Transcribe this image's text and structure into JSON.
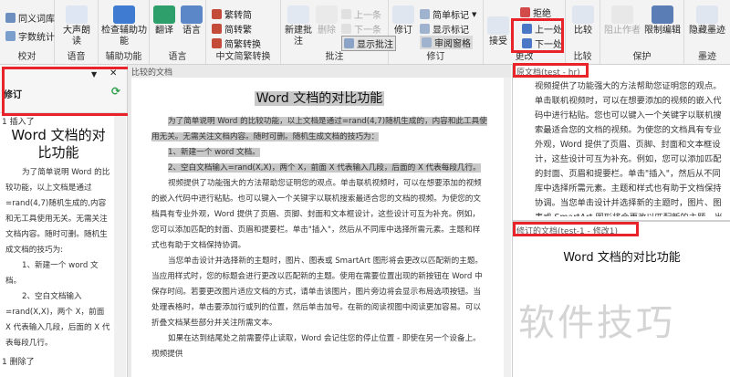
{
  "ribbon": {
    "word_groups": {
      "items": [
        "同义词库",
        "字数统计"
      ],
      "label": "校对"
    },
    "speak": {
      "label": "大声朗读",
      "group": "语音"
    },
    "check": {
      "label": "检查辅助功能",
      "group": "辅助功能"
    },
    "translate": {
      "label": "翻译"
    },
    "language": {
      "label": "语言",
      "group": "语言"
    },
    "chinese": {
      "items": [
        "繁转简",
        "简转繁",
        "简繁转换"
      ],
      "group": "中文简繁转换"
    },
    "comments": {
      "new": "新建批注",
      "delete": "删除",
      "prev": "上一条",
      "next": "下一条",
      "show": "显示批注",
      "group": "批注"
    },
    "tracking": {
      "track": "修订",
      "markup": "简单标记",
      "show_markup": "显示标记",
      "pane": "审阅窗格",
      "group": "修订"
    },
    "changes": {
      "accept": "接受",
      "reject": "拒绝",
      "prev": "上一处",
      "next": "下一处",
      "group": "更改"
    },
    "compare": {
      "label": "比较",
      "group": "比较"
    },
    "protect": {
      "block": "阻止作者",
      "restrict": "限制编辑",
      "group": "保护"
    },
    "ink": {
      "label": "隐藏墨迹",
      "group": "墨迹"
    }
  },
  "left_pane": {
    "title": "修订",
    "item1": "1  插入了",
    "heading": "Word 文档的对比功能",
    "text": "为了简单说明 Word 的比较功能，以上文档是通过 =rand(4,7)随机生成的,内容和无工具使用无关。无需关注文档内容。随时可删。随机生成文档的技巧为:",
    "list1": "1、新建一个 word 文档。",
    "list2": "2、空白文档输入=rand(X,X)，两个 X，前面 X 代表输入几段，后面的 X 代表每段几行。",
    "item2": "1  删除了"
  },
  "main": {
    "tab_label": "比较的文档",
    "title": "Word 文档的对比功能",
    "p1": "为了简单说明 Word 的比较功能，以上文档是通过=rand(4,7)随机生成的，内容和此工具使用无关。无需关注文档内容。随时可删。随机生成文档的技巧为：",
    "p2": "1、新建一个 word 文档。",
    "p3": "2、空白文档输入=rand(X,X)，两个 X，前面 X 代表输入几段，后面的 X 代表每段几行。",
    "p4": "视频提供了功能强大的方法帮助您证明您的观点。单击联机视频时，可以在想要添加的视频的嵌入代码中进行粘贴。也可以键入一个关键字以联机搜索最适合您的文档的视频。为使您的文档具有专业外观，Word 提供了页眉、页脚、封面和文本框设计，这些设计可互为补充。例如，您可以添加匹配的封面、页眉和提要栏。单击\"插入\"，然后从不同库中选择所需元素。主题和样式也有助于文档保持协调。",
    "p5": "当您单击设计并选择新的主题时，图片、图表或 SmartArt 图形将会更改以匹配新的主题。当应用样式时，您的标题会进行更改以匹配新的主题。使用在需要位置出现的新按钮在 Word 中保存时间。若要更改图片适应文档的方式，请单击该图片，图片旁边将会显示布局选项按钮。当处理表格时，单击要添加行或列的位置，然后单击加号。在新的阅读视图中阅读更加容易。可以折叠文档某些部分并关注所需文本。",
    "p6": "如果在达到结尾处之前需要停止读取，Word 会记住您的停止位置 - 即使在另一个设备上。视频提供"
  },
  "right_pane": {
    "orig_label": "原文档(test - hr)",
    "orig_text": "视频提供了功能强大的方法帮助您证明您的观点。单击联机视频时，可以在想要添加的视频的嵌入代码中进行粘贴。您也可以键入一个关键字以联机搜索最适合您的文档的视频。为使您的文档具有专业外观，Word 提供了页眉、页脚、封面和文本框设计，这些设计可互为补充。例如，您可以添加匹配的封面、页眉和提要栏。单击\"插入\"，然后从不同库中选择所需元素。主题和样式也有助于文档保持协调。当您单击设计并选择新的主题时，图片、图表或 SmartArt 图形将会更改以匹配新的主题。当应用样式",
    "rev_label": "修订的文档(test-1 - 修改1)",
    "rev_title": "Word 文档的对比功能",
    "watermark": "软件技巧"
  }
}
